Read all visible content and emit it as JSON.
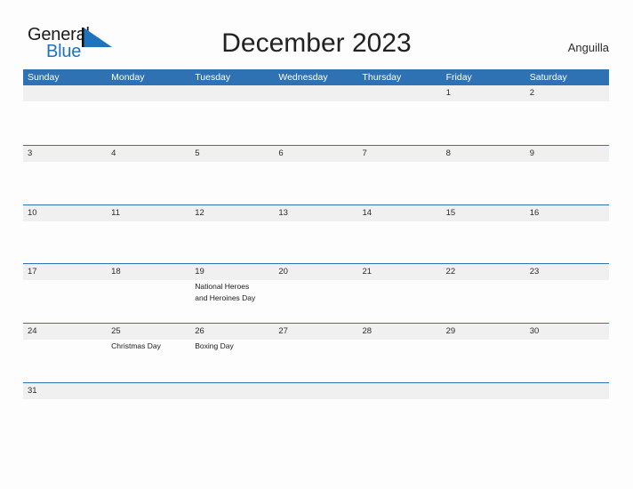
{
  "branding": {
    "logo_text_primary": "General",
    "logo_text_secondary": "Blue",
    "flag_icon": "blue-triangle-flag-icon",
    "accent_color": "#1e73be"
  },
  "header": {
    "title": "December 2023",
    "location": "Anguilla"
  },
  "calendar": {
    "month": "December",
    "year": "2023",
    "header_background_color": "#2f72b4",
    "date_band_color": "#f0f0f0",
    "row_separator_color": "#2f72b4",
    "weekdays": [
      "Sunday",
      "Monday",
      "Tuesday",
      "Wednesday",
      "Thursday",
      "Friday",
      "Saturday"
    ],
    "weeks": [
      {
        "days": [
          {
            "date": "",
            "events": []
          },
          {
            "date": "",
            "events": []
          },
          {
            "date": "",
            "events": []
          },
          {
            "date": "",
            "events": []
          },
          {
            "date": "",
            "events": []
          },
          {
            "date": "1",
            "events": []
          },
          {
            "date": "2",
            "events": []
          }
        ]
      },
      {
        "days": [
          {
            "date": "3",
            "events": []
          },
          {
            "date": "4",
            "events": []
          },
          {
            "date": "5",
            "events": []
          },
          {
            "date": "6",
            "events": []
          },
          {
            "date": "7",
            "events": []
          },
          {
            "date": "8",
            "events": []
          },
          {
            "date": "9",
            "events": []
          }
        ]
      },
      {
        "days": [
          {
            "date": "10",
            "events": []
          },
          {
            "date": "11",
            "events": []
          },
          {
            "date": "12",
            "events": []
          },
          {
            "date": "13",
            "events": []
          },
          {
            "date": "14",
            "events": []
          },
          {
            "date": "15",
            "events": []
          },
          {
            "date": "16",
            "events": []
          }
        ]
      },
      {
        "days": [
          {
            "date": "17",
            "events": []
          },
          {
            "date": "18",
            "events": []
          },
          {
            "date": "19",
            "events": [
              "National Heroes\nand Heroines Day"
            ]
          },
          {
            "date": "20",
            "events": []
          },
          {
            "date": "21",
            "events": []
          },
          {
            "date": "22",
            "events": []
          },
          {
            "date": "23",
            "events": []
          }
        ]
      },
      {
        "days": [
          {
            "date": "24",
            "events": []
          },
          {
            "date": "25",
            "events": [
              "Christmas Day"
            ]
          },
          {
            "date": "26",
            "events": [
              "Boxing Day"
            ]
          },
          {
            "date": "27",
            "events": []
          },
          {
            "date": "28",
            "events": []
          },
          {
            "date": "29",
            "events": []
          },
          {
            "date": "30",
            "events": []
          }
        ]
      },
      {
        "days": [
          {
            "date": "31",
            "events": []
          },
          {
            "date": "",
            "events": []
          },
          {
            "date": "",
            "events": []
          },
          {
            "date": "",
            "events": []
          },
          {
            "date": "",
            "events": []
          },
          {
            "date": "",
            "events": []
          },
          {
            "date": "",
            "events": []
          }
        ]
      }
    ]
  }
}
